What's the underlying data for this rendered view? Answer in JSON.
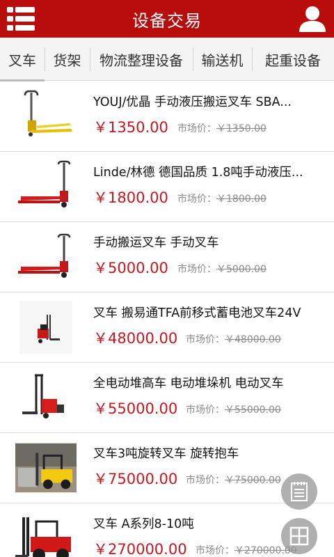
{
  "header": {
    "title": "设备交易"
  },
  "tabs": [
    {
      "label": "叉车",
      "active": true
    },
    {
      "label": "货架",
      "active": false
    },
    {
      "label": "物流整理设备",
      "active": false
    },
    {
      "label": "输送机",
      "active": false
    },
    {
      "label": "起重设备",
      "active": false
    }
  ],
  "market_label": "市场价：",
  "items": [
    {
      "name": "YOUJ/优晶 手动液压搬运叉车 SBA...",
      "price": "￥1350.00",
      "market_price": "￥1350.00",
      "thumb": "yellow-pallet-jack"
    },
    {
      "name": "Linde/林德 德国品质 1.8吨手动液压...",
      "price": "￥1800.00",
      "market_price": "￥1800.00",
      "thumb": "red-pallet-jack"
    },
    {
      "name": "手动搬运叉车 手动叉车",
      "price": "￥5000.00",
      "market_price": "￥5000.00",
      "thumb": "red-pallet-jack"
    },
    {
      "name": "叉车 搬易通TFA前移式蓄电池叉车24V",
      "price": "￥48000.00",
      "market_price": "￥48000.00",
      "thumb": "reach-truck"
    },
    {
      "name": "全电动堆高车 电动堆垛机 电动叉车",
      "price": "￥55000.00",
      "market_price": "￥55000.00",
      "thumb": "electric-stacker"
    },
    {
      "name": "叉车3吨旋转叉车 旋转抱车",
      "price": "￥75000.00",
      "market_price": "￥75000.00",
      "thumb": "yellow-forklift-photo"
    },
    {
      "name": "叉车 A系列8-10吨",
      "price": "￥270000.00",
      "market_price": "￥270000.00",
      "thumb": "red-heavy-forklift"
    }
  ],
  "colors": {
    "header_bg": "#b80d0d",
    "price": "#c8171e"
  },
  "icons": {
    "menu": "menu-icon",
    "user": "user-icon",
    "notes": "notepad-icon",
    "grid": "grid-icon"
  }
}
